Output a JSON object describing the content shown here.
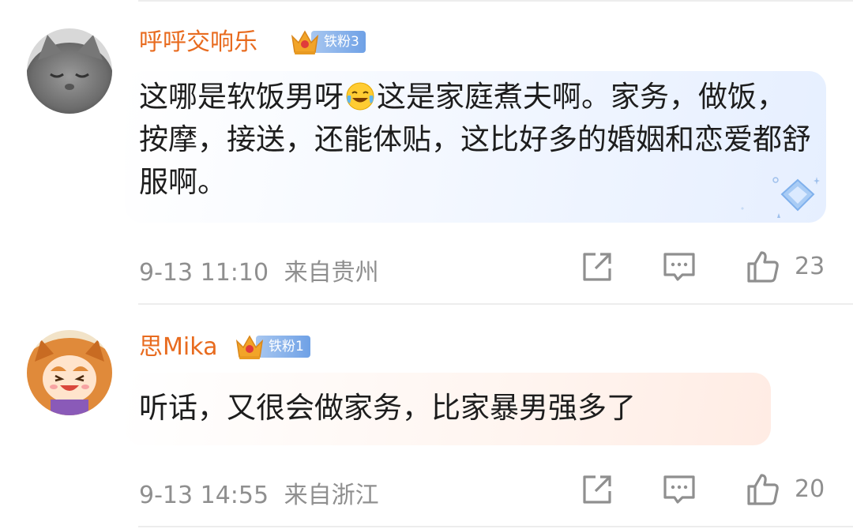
{
  "comments": [
    {
      "username": "呼呼交响乐",
      "fan_badge": "铁粉3",
      "text_before_emoji": "这哪是软饭男呀",
      "emoji": "laugh-cry-emoji",
      "text_after_emoji": "这是家庭煮夫啊。家务，做饭，按摩，接送，还能体贴，这比好多的婚姻和恋爱都舒服啊。",
      "time": "9-13 11:10",
      "location": "来自贵州",
      "likes": "23"
    },
    {
      "username": "思Mika",
      "fan_badge": "铁粉1",
      "text": "听话，又很会做家务，比家暴男强多了",
      "time": "9-13 14:55",
      "location": "来自浙江",
      "likes": "20"
    }
  ],
  "colors": {
    "username": "#e86b1f",
    "meta": "#8f8f8f",
    "badge_blue": "#6fa1e6",
    "crown": "#f2a428"
  }
}
